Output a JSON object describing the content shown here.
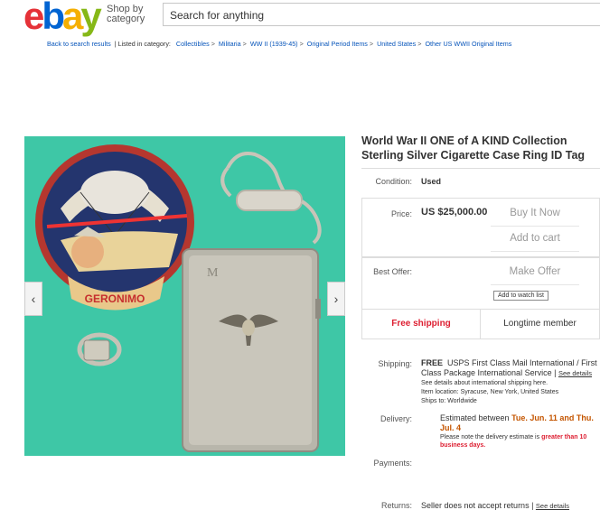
{
  "header": {
    "logo_letters": [
      "e",
      "b",
      "a",
      "y"
    ],
    "logo_colors": [
      "#e53238",
      "#0064d2",
      "#f5af02",
      "#86b817"
    ],
    "shop_by_line1": "Shop by",
    "shop_by_line2": "category",
    "search_placeholder": "Search for anything"
  },
  "breadcrumb": {
    "back": "Back to search results",
    "listed_in": "| Listed in category:",
    "items": [
      "Collectibles",
      "Militaria",
      "WW II (1939-45)",
      "Original Period Items",
      "United States",
      "Other US WWII Original Items"
    ]
  },
  "gallery": {
    "prev": "‹",
    "next": "›",
    "patch_text": "GERONIMO",
    "case_monogram": "M"
  },
  "listing": {
    "title": "World War II ONE of A KIND Collection Sterling Silver Cigarette Case Ring ID Tag",
    "condition_label": "Condition:",
    "condition_value": "Used",
    "price_label": "Price:",
    "price_value": "US $25,000.00",
    "buy_now": "Buy It Now",
    "add_to_cart": "Add to cart",
    "best_offer_label": "Best Offer:",
    "make_offer": "Make Offer",
    "watch_list": "Add to watch list",
    "free_shipping": "Free shipping",
    "longtime_member": "Longtime member",
    "shipping_label": "Shipping:",
    "shipping_free": "FREE",
    "shipping_line1": "USPS First Class Mail International / First",
    "shipping_line2": "Class Package International Service |",
    "see_details": "See details",
    "shipping_note": "See details about international shipping here.",
    "item_location": "Item location:  Syracuse, New York, United States",
    "ships_to": "Ships to:  Worldwide",
    "delivery_label": "Delivery:",
    "delivery_prefix": "Estimated between",
    "delivery_dates_1": "Tue. Jun. 11 and Thu.",
    "delivery_dates_2": "Jul. 4",
    "delivery_note_prefix": "Please note the delivery estimate is",
    "delivery_note_red": "greater than 10 business days.",
    "payments_label": "Payments:",
    "returns_label": "Returns:",
    "returns_value": "Seller does not accept returns |",
    "returns_details": "See details"
  }
}
